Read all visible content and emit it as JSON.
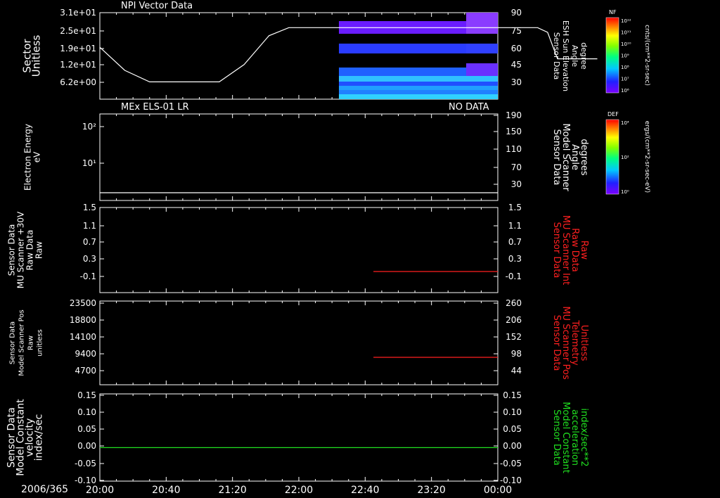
{
  "colors": {
    "background": "#000000",
    "axis": "#ffffff",
    "red": "#ff2020",
    "green": "#20e020"
  },
  "time_axis": {
    "date": "2006/365",
    "ticks": [
      "20:00",
      "20:40",
      "21:20",
      "22:00",
      "22:40",
      "23:20",
      "00:00"
    ]
  },
  "colorbars": {
    "nf": {
      "tag": "NF",
      "unit": "cnts/(cm**2-sr-sec)",
      "ticks": [
        "10¹²",
        "10¹¹",
        "10¹⁰",
        "10⁹",
        "10⁸",
        "10⁷",
        "10⁶"
      ]
    },
    "def": {
      "tag": "DEF",
      "unit": "ergs/(cm**2-sr-sec-eV)",
      "ticks": [
        "10⁴",
        "10²",
        "10⁰"
      ]
    }
  },
  "chart_data": [
    {
      "type": "heatmap",
      "title": "NPI Vector Data",
      "ylabel": [
        "Sector",
        "Unitless"
      ],
      "left_ticks": [
        "3.1e+01",
        "2.5e+01",
        "1.9e+01",
        "1.2e+01",
        "6.2e+00"
      ],
      "right_ylabel": [
        "Sensor Data",
        "ESH Sun Elevation",
        "Angle",
        "degree"
      ],
      "right_ticks": [
        "90",
        "75",
        "60",
        "45",
        "30"
      ],
      "right_ylim": [
        15,
        90
      ],
      "line": {
        "x_hours": [
          0,
          0.25,
          0.5,
          1.0,
          1.2,
          1.45,
          1.7,
          1.9,
          3.0,
          4.0,
          4.4,
          4.5,
          4.6,
          4.75,
          5.0
        ],
        "y_degree": [
          60,
          40,
          30,
          30,
          30,
          45,
          70,
          77,
          77,
          77,
          77,
          73,
          50,
          50,
          50
        ]
      }
    },
    {
      "type": "line",
      "title": "MEx ELS-01 LR",
      "status": "NO DATA",
      "ylabel": [
        "Electron Energy",
        "eV"
      ],
      "left_ticks": [
        "10²",
        "10¹"
      ],
      "right_ylabel": [
        "Sensor Data",
        "Model Scanner",
        "Angle",
        "degrees"
      ],
      "right_ticks": [
        "190",
        "150",
        "110",
        "70",
        "30"
      ],
      "right_ylim": [
        0,
        190
      ],
      "line": {
        "x_hours": [
          0,
          4
        ],
        "y": [
          10,
          10
        ]
      }
    },
    {
      "type": "line",
      "ylabel": [
        "Sensor Data",
        "MU Scanner +30V",
        "Raw Data",
        "Raw"
      ],
      "left_ticks": [
        "1.5",
        "1.1",
        "0.7",
        "0.3",
        "-0.1"
      ],
      "right_ylabel": [
        "Sensor Data",
        "MU Scanner Int",
        "Raw Data",
        "Raw"
      ],
      "right_ticks": [
        "1.5",
        "1.1",
        "0.7",
        "0.3",
        "-0.1"
      ],
      "ylim": [
        -0.5,
        1.5
      ],
      "line": {
        "x_hours": [
          2.75,
          4
        ],
        "y": [
          0.0,
          0.0
        ]
      }
    },
    {
      "type": "line",
      "ylabel": [
        "Sensor Data",
        "Model Scanner Pos",
        "Raw",
        "unitless"
      ],
      "left_ticks": [
        "23500",
        "18800",
        "14100",
        "9400",
        "4700"
      ],
      "right_ylabel": [
        "Sensor Data",
        "MU Scanner Pos",
        "Telemetry",
        "Unitless"
      ],
      "right_ticks": [
        "260",
        "206",
        "152",
        "98",
        "44"
      ],
      "right_ylim": [
        -10,
        260
      ],
      "line": {
        "x_hours": [
          2.75,
          4
        ],
        "y": [
          86,
          86
        ]
      }
    },
    {
      "type": "line",
      "ylabel": [
        "Sensor Data",
        "Model Constant",
        "velocity",
        "index/sec"
      ],
      "left_ticks": [
        "0.15",
        "0.10",
        "0.05",
        "0.00",
        "-0.05",
        "-0.10"
      ],
      "right_ylabel": [
        "Sensor Data",
        "Model Constant",
        "acceleration",
        "index/sec**2"
      ],
      "right_ticks": [
        "0.15",
        "0.10",
        "0.05",
        "0.00",
        "-0.05",
        "-0.10"
      ],
      "ylim": [
        -0.1,
        0.15
      ],
      "line": {
        "x_hours": [
          0,
          4
        ],
        "y": [
          0.0,
          0.0
        ]
      }
    }
  ]
}
